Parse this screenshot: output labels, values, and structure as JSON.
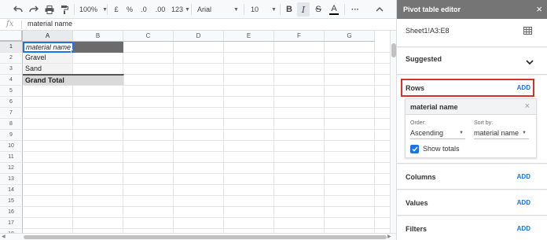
{
  "toolbar": {
    "undo_icon": "undo-icon",
    "redo_icon": "redo-icon",
    "print_icon": "print-icon",
    "paint_format_icon": "paint-format-icon",
    "zoom": "100%",
    "currency": "£",
    "percent": "%",
    "decrease_decimals": ".0",
    "increase_decimals": ".00",
    "more_formats": "123",
    "font": "Arial",
    "font_size": "10",
    "bold": "B",
    "italic": "I",
    "strikethrough": "S",
    "text_color": "A",
    "more": "···",
    "collapse_icon": "chevron-up-icon"
  },
  "formula_bar": {
    "fx": "fx",
    "value": "material name"
  },
  "grid": {
    "columns": [
      "A",
      "B",
      "C",
      "D",
      "E",
      "F",
      "G"
    ],
    "rows": [
      "1",
      "2",
      "3",
      "4",
      "5",
      "6",
      "7",
      "8",
      "9",
      "10",
      "11",
      "12",
      "13",
      "14",
      "15",
      "16",
      "17",
      "18"
    ],
    "cells": {
      "a1": "material name",
      "a2": "Gravel",
      "a3": "Sand",
      "a4": "Grand Total"
    }
  },
  "panel": {
    "title": "Pivot table editor",
    "close": "×",
    "range": "Sheet1!A3:E8",
    "suggested": "Suggested",
    "rows_label": "Rows",
    "add": "ADD",
    "row_card": {
      "title": "material name",
      "close": "×",
      "order_label": "Order:",
      "order_value": "Ascending",
      "sortby_label": "Sort by:",
      "sortby_value": "material name",
      "show_totals": "Show totals",
      "show_totals_checked": true
    },
    "columns_label": "Columns",
    "values_label": "Values",
    "filters_label": "Filters",
    "highlight_color": "#d93025",
    "accent_color": "#1a73e8"
  }
}
